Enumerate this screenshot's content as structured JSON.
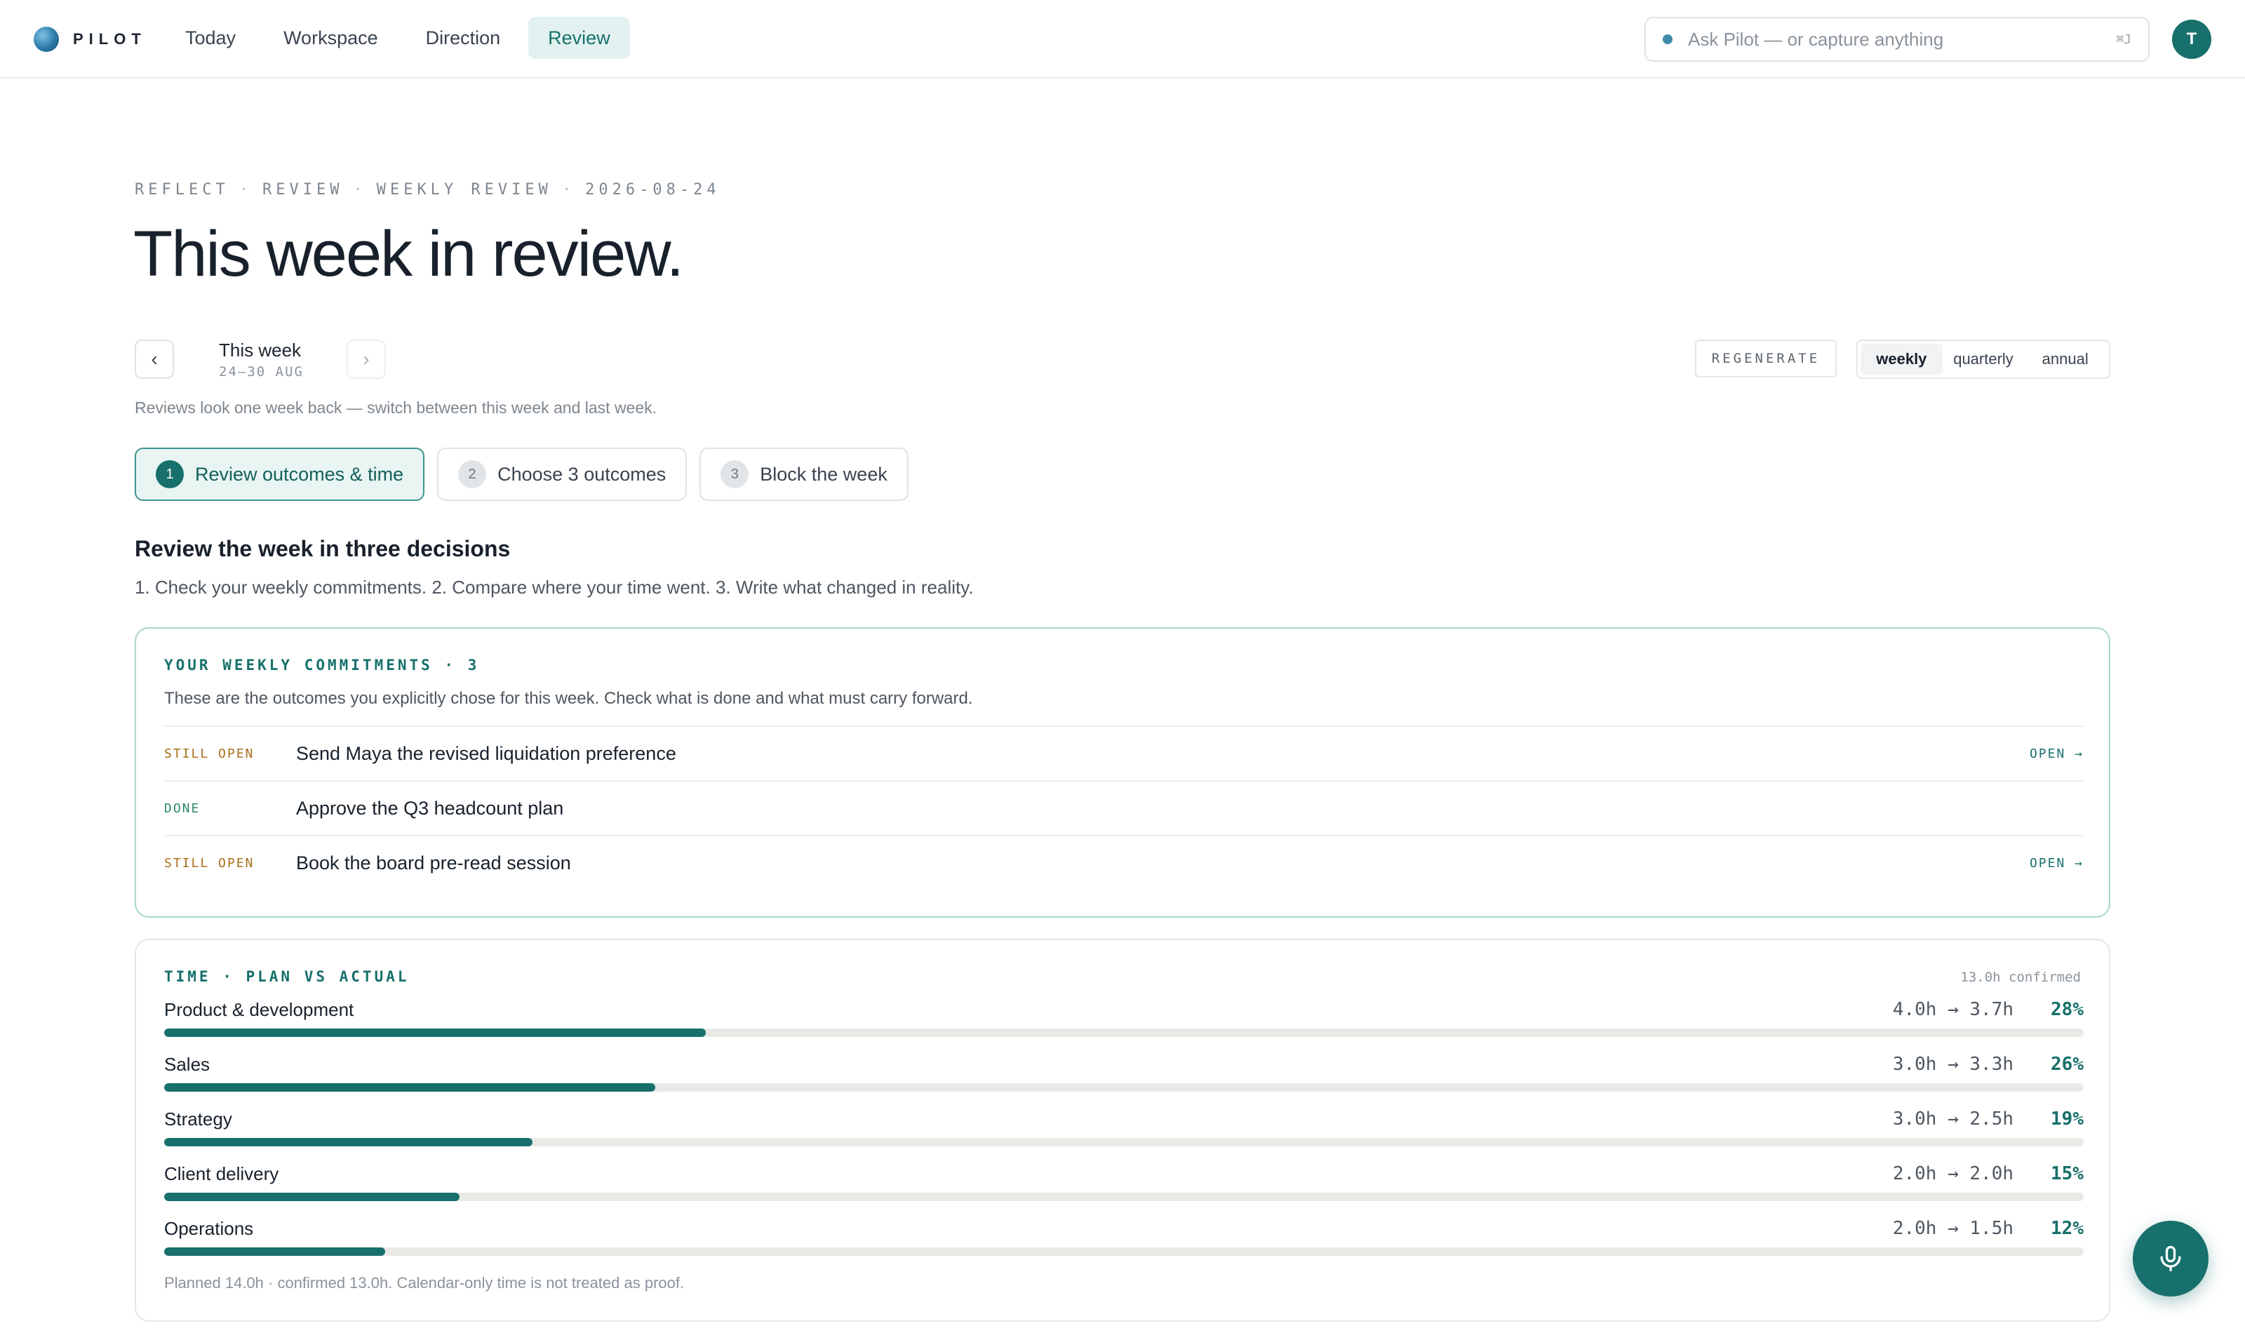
{
  "app": {
    "name": "PILOT"
  },
  "nav": [
    {
      "label": "Today",
      "active": false
    },
    {
      "label": "Workspace",
      "active": false
    },
    {
      "label": "Direction",
      "active": false
    },
    {
      "label": "Review",
      "active": true
    }
  ],
  "search": {
    "placeholder": "Ask Pilot — or capture anything",
    "shortcut": "⌘J"
  },
  "user": {
    "initial": "T"
  },
  "breadcrumbs": [
    "REFLECT",
    "REVIEW",
    "WEEKLY REVIEW",
    "2026-08-24"
  ],
  "page_title": "This week in review.",
  "week": {
    "title": "This week",
    "range": "24–30 AUG",
    "note": "Reviews look one week back — switch between this week and last week.",
    "prev_icon": "‹",
    "next_icon": "›"
  },
  "actions": {
    "regenerate": "REGENERATE"
  },
  "period": {
    "options": [
      "weekly",
      "quarterly",
      "annual"
    ],
    "selected": "weekly"
  },
  "steps": [
    {
      "num": "1",
      "label": "Review outcomes & time",
      "active": true
    },
    {
      "num": "2",
      "label": "Choose 3 outcomes",
      "active": false
    },
    {
      "num": "3",
      "label": "Block the week",
      "active": false
    }
  ],
  "section": {
    "title": "Review the week in three decisions",
    "subtitle": "1. Check your weekly commitments. 2. Compare where your time went. 3. Write what changed in reality."
  },
  "commitments": {
    "heading": "YOUR WEEKLY COMMITMENTS · 3",
    "description": "These are the outcomes you explicitly chose for this week. Check what is done and what must carry forward.",
    "items": [
      {
        "status": "STILL OPEN",
        "state": "open",
        "text": "Send Maya the revised liquidation preference",
        "link": "OPEN →"
      },
      {
        "status": "DONE",
        "state": "done",
        "text": "Approve the Q3 headcount plan",
        "link": ""
      },
      {
        "status": "STILL OPEN",
        "state": "open",
        "text": "Book the board pre-read session",
        "link": "OPEN →"
      }
    ]
  },
  "time": {
    "heading": "TIME · PLAN VS ACTUAL",
    "confirmed": "13.0h confirmed",
    "rows": [
      {
        "label": "Product & development",
        "hours": "4.0h → 3.7h",
        "pct": "28%",
        "fill": 0.282
      },
      {
        "label": "Sales",
        "hours": "3.0h → 3.3h",
        "pct": "26%",
        "fill": 0.256
      },
      {
        "label": "Strategy",
        "hours": "3.0h → 2.5h",
        "pct": "19%",
        "fill": 0.192
      },
      {
        "label": "Client delivery",
        "hours": "2.0h → 2.0h",
        "pct": "15%",
        "fill": 0.154
      },
      {
        "label": "Operations",
        "hours": "2.0h → 1.5h",
        "pct": "12%",
        "fill": 0.115
      }
    ],
    "footnote": "Planned 14.0h · confirmed 13.0h. Calendar-only time is not treated as proof."
  },
  "colors": {
    "accent": "#17706b",
    "warning": "#a8701c",
    "success": "#2e8a6e"
  }
}
